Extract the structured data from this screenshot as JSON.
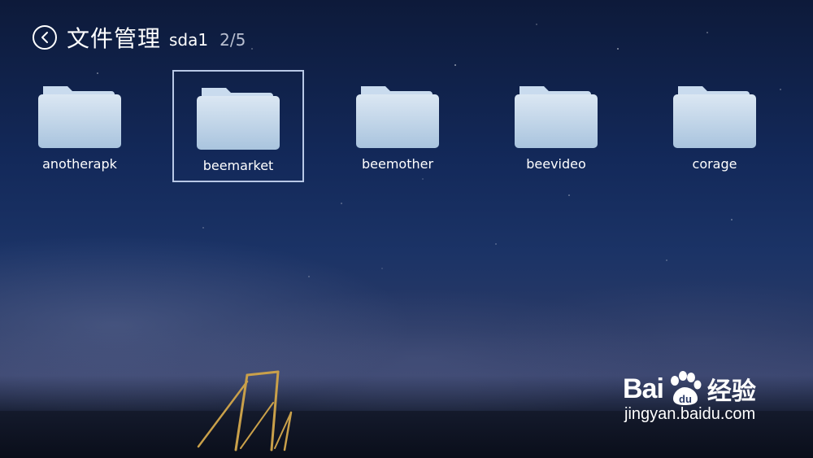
{
  "header": {
    "title": "文件管理",
    "volume": "sda1",
    "pager": "2/5"
  },
  "folders": [
    {
      "label": "anotherapk",
      "selected": false
    },
    {
      "label": "beemarket",
      "selected": true
    },
    {
      "label": "beemother",
      "selected": false
    },
    {
      "label": "beevideo",
      "selected": false
    },
    {
      "label": "corage",
      "selected": false
    }
  ],
  "watermark": {
    "brand_left": "Bai",
    "brand_right": "经验",
    "url": "jingyan.baidu.com"
  },
  "colors": {
    "folder_top": "#dbe7f3",
    "folder_bottom": "#a9c4de",
    "selection_border": "#b8c8e6",
    "sky_top": "#0d1a3a"
  }
}
